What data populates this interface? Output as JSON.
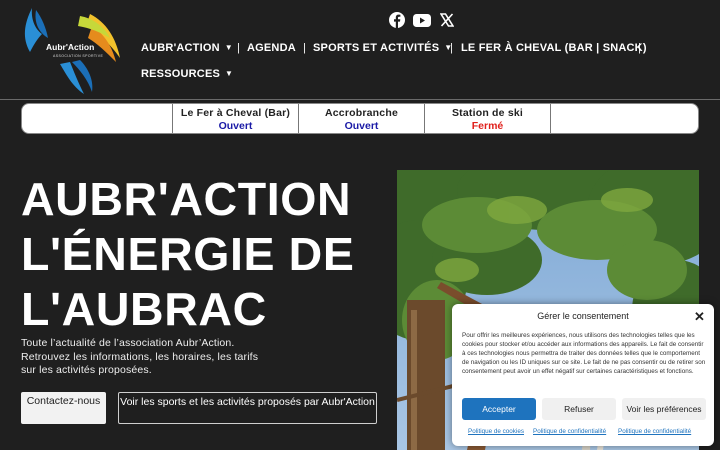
{
  "logo": {
    "name": "Aubr'Action",
    "tagline": "ASSOCIATION SPORTIVE"
  },
  "social": {
    "facebook": "facebook-icon",
    "youtube": "youtube-icon",
    "x": "x-icon"
  },
  "nav": {
    "items": [
      {
        "label": "AUBR'ACTION",
        "dropdown": true
      },
      {
        "label": "AGENDA",
        "dropdown": false
      },
      {
        "label": "SPORTS ET ACTIVITÉS",
        "dropdown": true
      },
      {
        "label": "LE FER À CHEVAL (BAR | SNACK)",
        "dropdown": false
      },
      {
        "label": "RESSOURCES",
        "dropdown": true
      }
    ],
    "separator": "|"
  },
  "status": [
    {
      "name": "Le Fer à Cheval (Bar)",
      "value": "Ouvert",
      "color": "#1a1aa6"
    },
    {
      "name": "Accrobranche",
      "value": "Ouvert",
      "color": "#1a1aa6"
    },
    {
      "name": "Station de ski",
      "value": "Fermé",
      "color": "#e0201c"
    }
  ],
  "hero": {
    "line1": "AUBR'ACTION",
    "line2": "L'ÉNERGIE DE",
    "line3": "L'AUBRAC",
    "text": "Toute l’actualité de l’association Aubr’Action. Retrouvez les informations, les horaires, les tarifs sur les activités proposées.",
    "btn_contact": "Contactez-nous",
    "btn_sports": "Voir les sports et les activités proposés par Aubr'Action"
  },
  "consent": {
    "title": "Gérer le consentement",
    "text": "Pour offrir les meilleures expériences, nous utilisons des technologies telles que les cookies pour stocker et/ou accéder aux informations des appareils. Le fait de consentir à ces technologies nous permettra de traiter des données telles que le comportement de navigation ou les ID uniques sur ce site. Le fait de ne pas consentir ou de retirer son consentement peut avoir un effet négatif sur certaines caractéristiques et fonctions.",
    "accept": "Accepter",
    "refuse": "Refuser",
    "prefs": "Voir les préférences",
    "links": [
      "Politique de cookies",
      "Politique de confidentialité",
      "Politique de confidentialité"
    ]
  },
  "colors": {
    "background": "#1f1f1f",
    "accent_blue": "#1e73be",
    "open": "#1a1aa6",
    "closed": "#e0201c"
  }
}
